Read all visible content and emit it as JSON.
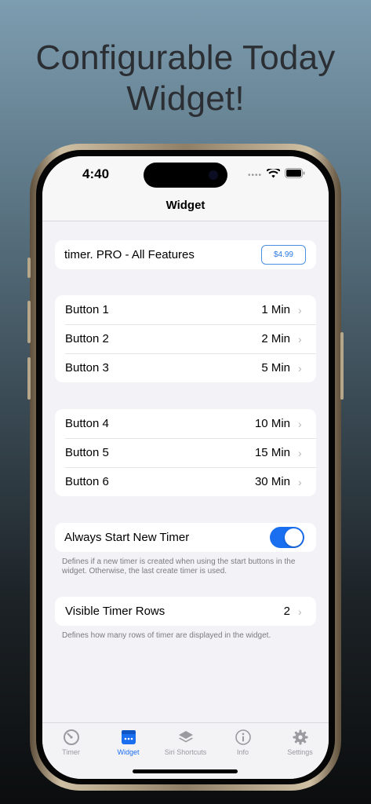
{
  "headline": [
    "Configurable Today",
    "Widget!"
  ],
  "status": {
    "time": "4:40",
    "dots": "••••"
  },
  "nav": {
    "title": "Widget"
  },
  "pro": {
    "label": "timer. PRO - All Features",
    "price": "$4.99"
  },
  "buttons_group1": [
    {
      "label": "Button 1",
      "value": "1 Min"
    },
    {
      "label": "Button 2",
      "value": "2 Min"
    },
    {
      "label": "Button 3",
      "value": "5 Min"
    }
  ],
  "buttons_group2": [
    {
      "label": "Button 4",
      "value": "10 Min"
    },
    {
      "label": "Button 5",
      "value": "15 Min"
    },
    {
      "label": "Button 6",
      "value": "30 Min"
    }
  ],
  "always_new": {
    "label": "Always Start New Timer",
    "enabled": true,
    "footnote": "Defines if a new timer is created when using the start buttons in the widget. Otherwise, the last create timer is used."
  },
  "visible_rows": {
    "label": "Visible Timer Rows",
    "value": "2",
    "footnote": "Defines how many rows of timer are displayed in the widget."
  },
  "chevron": "›",
  "tabs": [
    {
      "label": "Timer",
      "icon": "timer-icon"
    },
    {
      "label": "Widget",
      "icon": "widget-icon",
      "active": true
    },
    {
      "label": "Siri Shortcuts",
      "icon": "layers-icon"
    },
    {
      "label": "Info",
      "icon": "info-icon"
    },
    {
      "label": "Settings",
      "icon": "gear-icon"
    }
  ],
  "colors": {
    "accent": "#1a6ef0",
    "background": "#f2f2f7"
  }
}
